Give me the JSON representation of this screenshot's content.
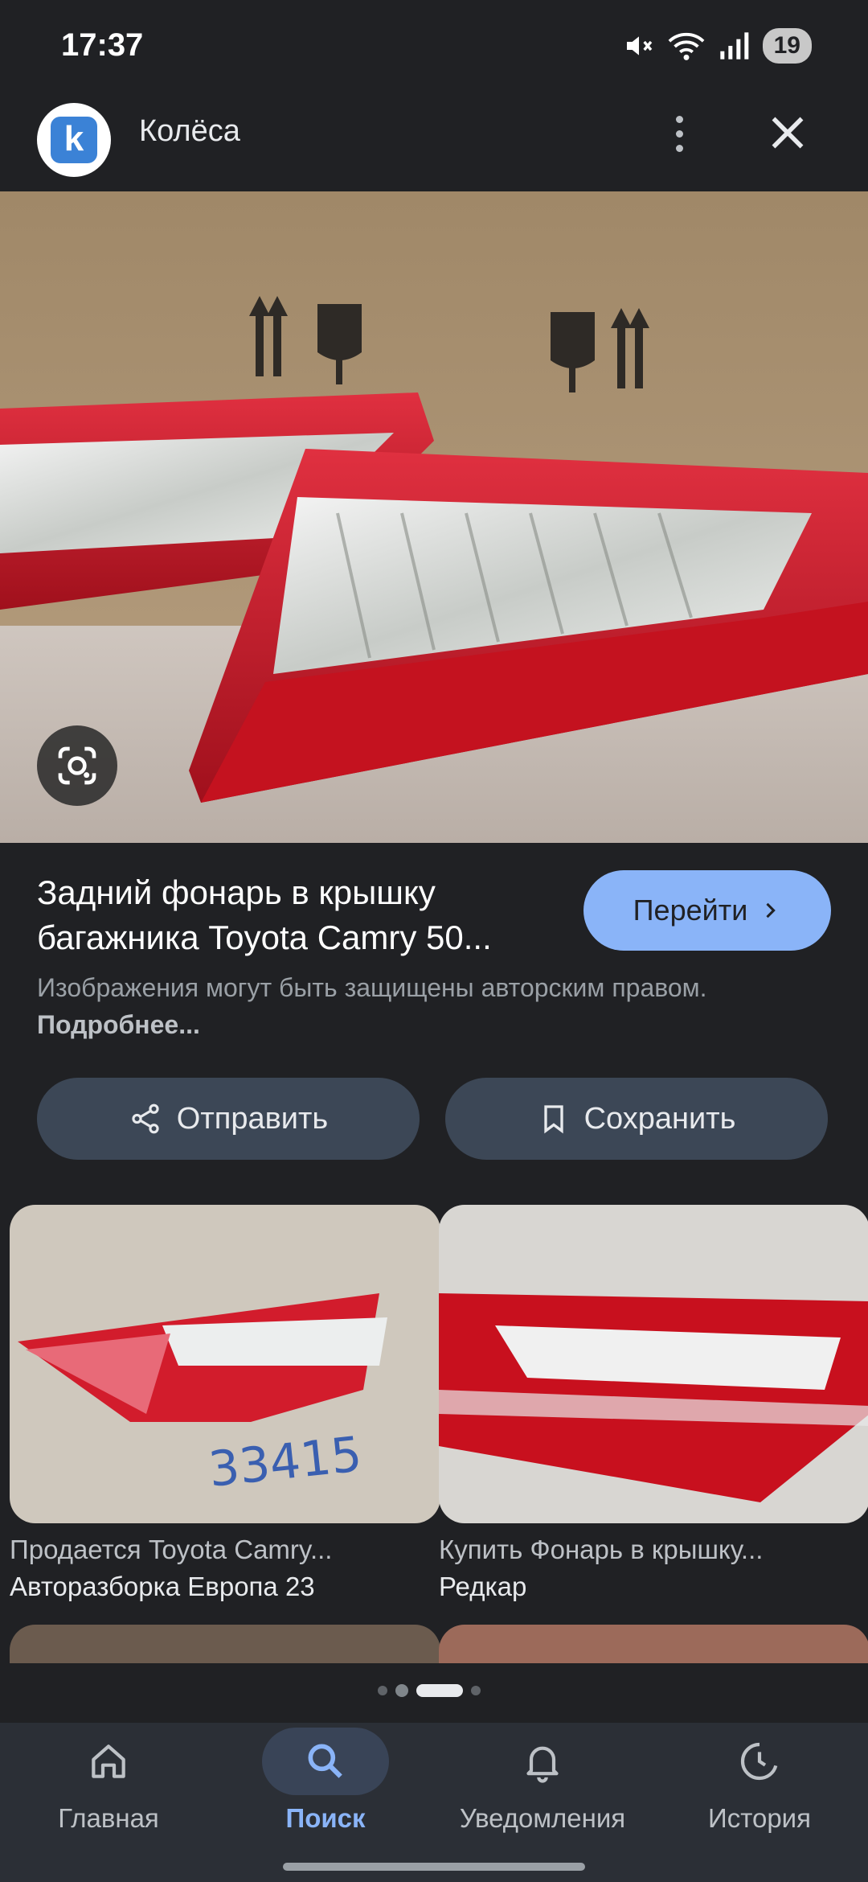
{
  "status_bar": {
    "time": "17:37",
    "battery": "19"
  },
  "header": {
    "logo_letter": "k",
    "title": "Колёса"
  },
  "result": {
    "title": "Задний фонарь в крышку багажника Toyota Camry 50...",
    "goto_label": "Перейти",
    "copyright_text": "Изображения могут быть защищены авторским правом.",
    "copyright_link": "Подробнее..."
  },
  "actions": {
    "share_label": "Отправить",
    "save_label": "Сохранить"
  },
  "related": [
    {
      "title": "Продается Toyota Camry...",
      "source": "Авторазборка Европа 23",
      "image_number": "33415"
    },
    {
      "title": "Купить Фонарь в крышку...",
      "source": "Редкар"
    }
  ],
  "bottom_nav": [
    {
      "label": "Главная",
      "icon": "home-icon",
      "active": false
    },
    {
      "label": "Поиск",
      "icon": "search-icon",
      "active": true
    },
    {
      "label": "Уведомления",
      "icon": "bell-icon",
      "active": false
    },
    {
      "label": "История",
      "icon": "history-icon",
      "active": false
    }
  ],
  "colors": {
    "background": "#202124",
    "accent": "#8ab4f8",
    "button": "#3c4756"
  }
}
